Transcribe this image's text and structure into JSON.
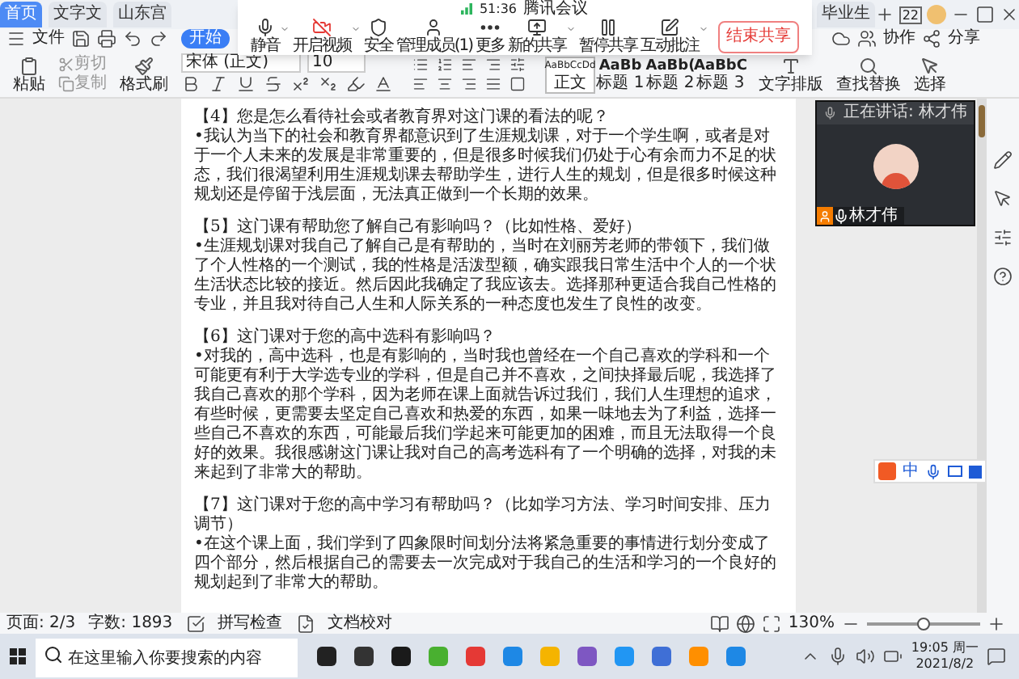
{
  "tabs": [
    {
      "label": "首页",
      "selected": true
    },
    {
      "label": "文字文",
      "selected": false
    },
    {
      "label": "山东宫",
      "selected": false
    },
    {
      "label": "毕业生",
      "selected": false
    }
  ],
  "title_bar": {
    "badge": "22"
  },
  "menu": {
    "file": "文件",
    "active": "开始",
    "collab": "协作",
    "share": "分享"
  },
  "ribbon": {
    "paste": "粘贴",
    "cut": "剪切",
    "copy": "复制",
    "painter": "格式刷",
    "font": "宋体 (正文)",
    "size": "10",
    "styles": [
      {
        "sample": "AaBbCcDd",
        "label": "正文",
        "selected": true
      },
      {
        "sample": "AaBb",
        "label": "标题 1",
        "selected": false
      },
      {
        "sample": "AaBb(",
        "label": "标题 2",
        "selected": false
      },
      {
        "sample": "AaBbC",
        "label": "标题 3",
        "selected": false
      }
    ],
    "layout": "文字排版",
    "find": "查找替换",
    "select": "选择"
  },
  "meeting": {
    "timer": "51:36",
    "title": "腾讯会议",
    "buttons": [
      {
        "kind": "mic",
        "label": "静音",
        "menu": true
      },
      {
        "kind": "video",
        "label": "开启视频",
        "menu": true
      },
      {
        "kind": "security",
        "label": "安全",
        "menu": false
      },
      {
        "kind": "members",
        "label": "管理成员(1)",
        "menu": false
      },
      {
        "kind": "more",
        "label": "更多",
        "menu": false
      },
      {
        "kind": "share",
        "label": "新的共享",
        "menu": true
      },
      {
        "kind": "pause",
        "label": "暂停共享",
        "menu": false
      },
      {
        "kind": "annotate",
        "label": "互动批注",
        "menu": true
      }
    ],
    "end": "结束共享"
  },
  "video": {
    "speaking": "正在讲话: 林才伟",
    "name": "林才伟"
  },
  "document": [
    {
      "heading": "【4】您是怎么看待社会或者教育界对这门课的看法的呢？",
      "body": "•我认为当下的社会和教育界都意识到了生涯规划课，对于一个学生啊，或者是对于一个人未来的发展是非常重要的，但是很多时候我们仍处于心有余而力不足的状态，我们很渴望利用生涯规划课去帮助学生，进行人生的规划，但是很多时候这种规划还是停留于浅层面，无法真正做到一个长期的效果。"
    },
    {
      "heading": "【5】这门课有帮助您了解自己有影响吗？（比如性格、爱好）",
      "body": "•生涯规划课对我自己了解自己是有帮助的，当时在刘丽芳老师的带领下，我们做了个人性格的一个测试，我的性格是活泼型额，确实跟我日常生活中个人的一个状生活状态比较的接近。然后因此我确定了我应该去。选择那种更适合我自己性格的专业，并且我对待自己人生和人际关系的一种态度也发生了良性的改变。"
    },
    {
      "heading": "【6】这门课对于您的高中选科有影响吗？",
      "body": "•对我的，高中选科，也是有影响的，当时我也曾经在一个自己喜欢的学科和一个可能更有利于大学选专业的学科，但是自己并不喜欢，之间抉择最后呢，我选择了我自己喜欢的那个学科，因为老师在课上面就告诉过我们，我们人生理想的追求，有些时候，更需要去坚定自己喜欢和热爱的东西，如果一味地去为了利益，选择一些自己不喜欢的东西，可能最后我们学起来可能更加的困难，而且无法取得一个良好的效果。我很感谢这门课让我对自己的高考选科有了一个明确的选择，对我的未来起到了非常大的帮助。"
    },
    {
      "heading": "【7】这门课对于您的高中学习有帮助吗？（比如学习方法、学习时间安排、压力调节）",
      "body": "•在这个课上面，我们学到了四象限时间划分法将紧急重要的事情进行划分变成了四个部分，然后根据自己的需要去一次完成对于我自己的生活和学习的一个良好的规划起到了非常大的帮助。"
    }
  ],
  "ime": {
    "label": "中"
  },
  "status_bar": {
    "page": "页面: 2/3",
    "words": "字数: 1893",
    "spell": "拼写检查",
    "proof": "文档校对",
    "zoom": "130%",
    "level": 0.5
  },
  "taskbar": {
    "search_placeholder": "在这里输入你要搜索的内容",
    "time": "19:05 周一",
    "date": "2021/8/2"
  }
}
